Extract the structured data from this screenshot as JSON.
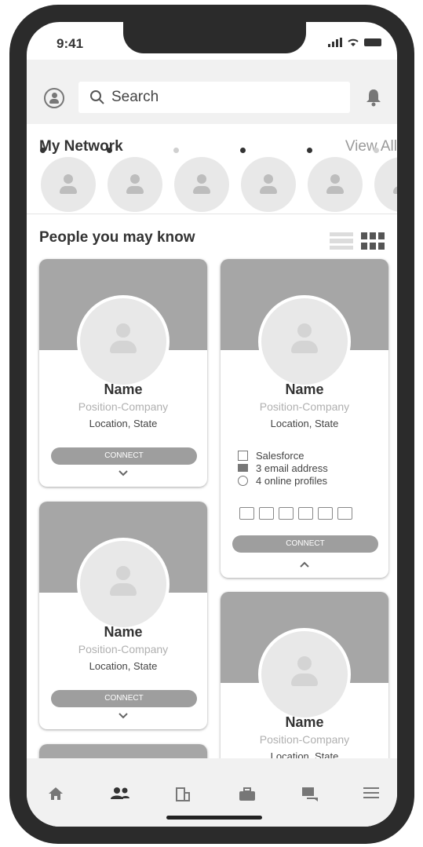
{
  "status": {
    "time": "9:41"
  },
  "search": {
    "placeholder": "Search"
  },
  "network": {
    "title": "My Network",
    "view_all": "View All",
    "online": [
      true,
      true,
      false,
      true,
      true,
      false
    ]
  },
  "people": {
    "title": "People you may know"
  },
  "cards": [
    {
      "name": "Name",
      "position": "Position-Company",
      "location": "Location, State",
      "connect": "CONNECT"
    },
    {
      "name": "Name",
      "position": "Position-Company",
      "location": "Location, State",
      "connect": "CONNECT",
      "details": {
        "company": "Salesforce",
        "email": "3 email address",
        "profiles": "4 online profiles"
      }
    },
    {
      "name": "Name",
      "position": "Position-Company",
      "location": "Location, State",
      "connect": "CONNECT"
    },
    {
      "name": "Name",
      "position": "Position-Company",
      "location": "Location, State"
    }
  ],
  "colors": {
    "dot_online": "#333333",
    "dot_offline": "#d0d0d0",
    "banner": "#a6a6a6",
    "button": "#9e9e9e"
  },
  "nav": [
    "home-icon",
    "people-icon",
    "company-icon",
    "jobs-icon",
    "messages-icon",
    "menu-icon"
  ]
}
